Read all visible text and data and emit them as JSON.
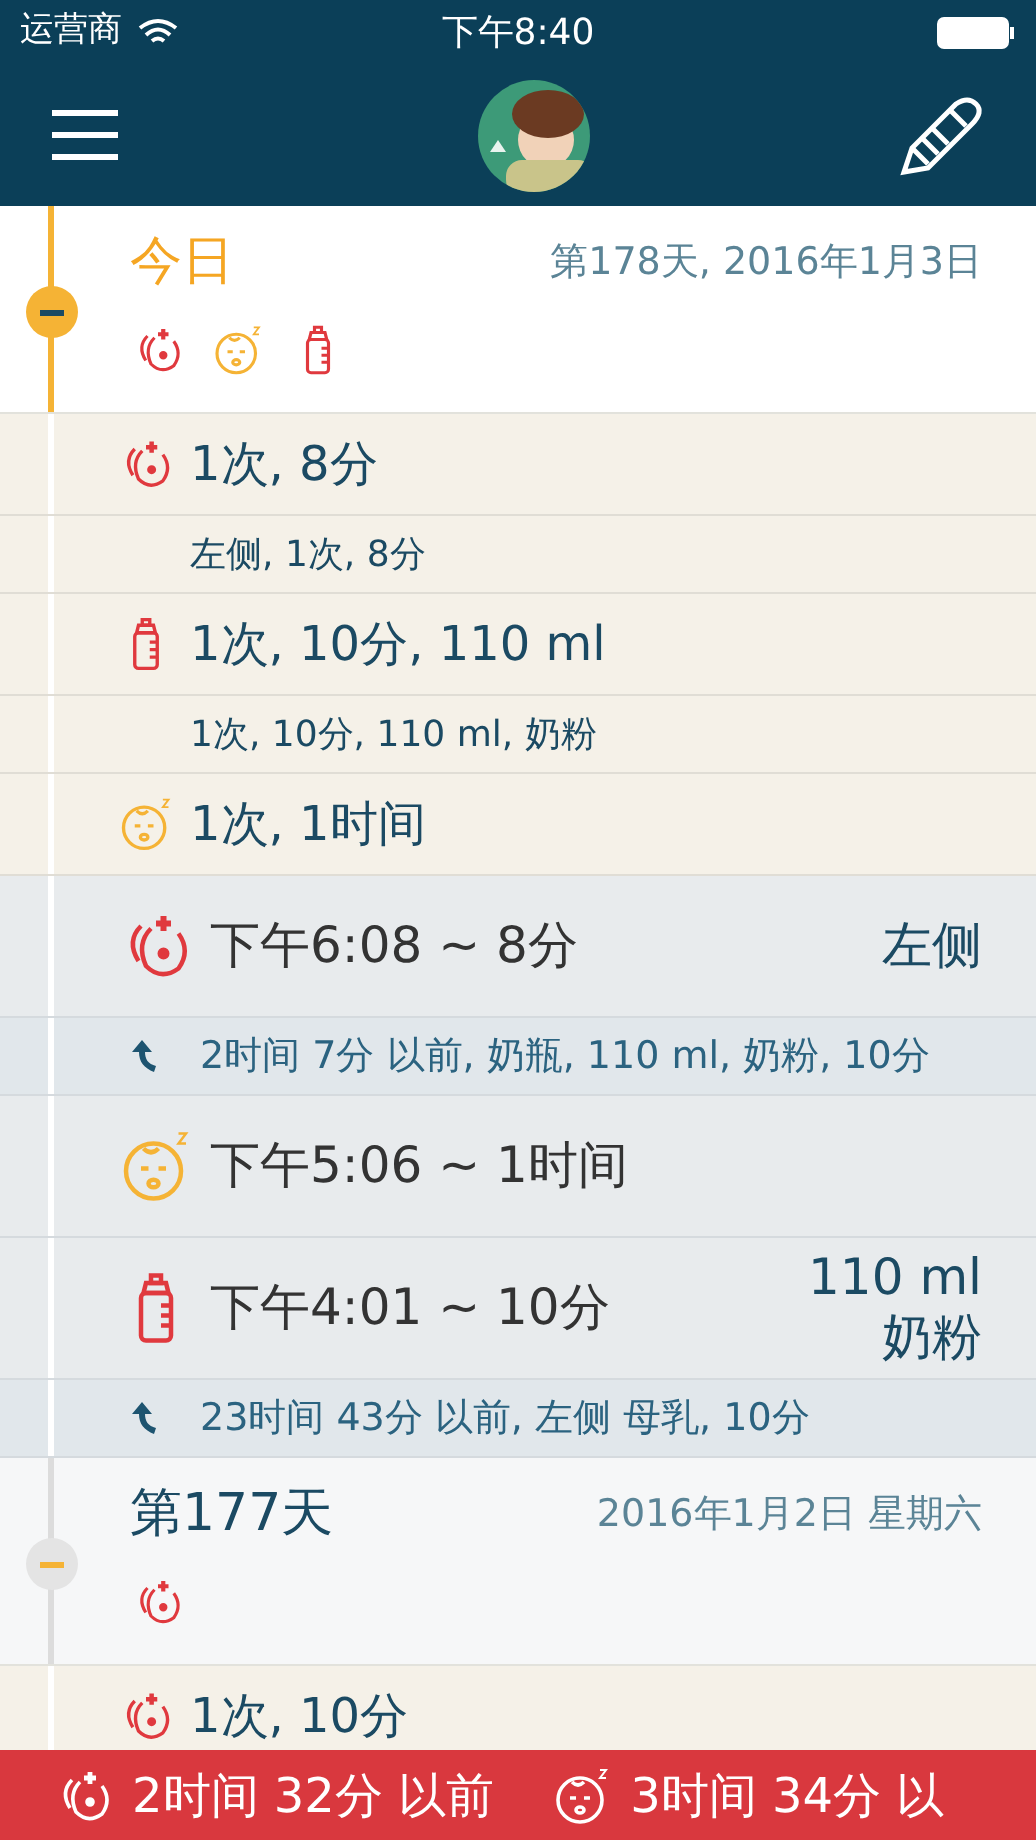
{
  "status_bar": {
    "carrier": "运营商",
    "time": "下午8:40"
  },
  "days": [
    {
      "title": "今日",
      "date": "第178天, 2016年1月3日",
      "today": true,
      "icons": [
        {
          "kind": "breast"
        },
        {
          "kind": "sleep"
        },
        {
          "kind": "bottle"
        }
      ],
      "summary": [
        {
          "kind": "breast",
          "text": "1次, 8分",
          "detail": "左侧, 1次, 8分"
        },
        {
          "kind": "bottle",
          "text": "1次, 10分, 110 ml",
          "detail": "1次, 10分, 110 ml, 奶粉"
        },
        {
          "kind": "sleep",
          "text": "1次, 1时间"
        }
      ],
      "events": [
        {
          "kind": "breast",
          "time": "下午6:08 ~ 8分",
          "info": [
            "左侧"
          ],
          "previous": "2时间 7分 以前, 奶瓶, 110 ml, 奶粉, 10分"
        },
        {
          "kind": "sleep",
          "time": "下午5:06 ~ 1时间"
        },
        {
          "kind": "bottle",
          "time": "下午4:01 ~ 10分",
          "info": [
            "110 ml",
            "奶粉"
          ],
          "previous": "23时间 43分 以前, 左侧 母乳, 10分"
        }
      ]
    },
    {
      "title": "第177天",
      "date": "2016年1月2日 星期六",
      "today": false,
      "icons": [
        {
          "kind": "breast"
        }
      ],
      "summary": [
        {
          "kind": "breast",
          "text": "1次, 10分"
        }
      ]
    }
  ],
  "bottom_bar": [
    {
      "kind": "breast",
      "text": "2时间 32分 以前"
    },
    {
      "kind": "sleep",
      "text": "3时间 34分 以"
    }
  ]
}
